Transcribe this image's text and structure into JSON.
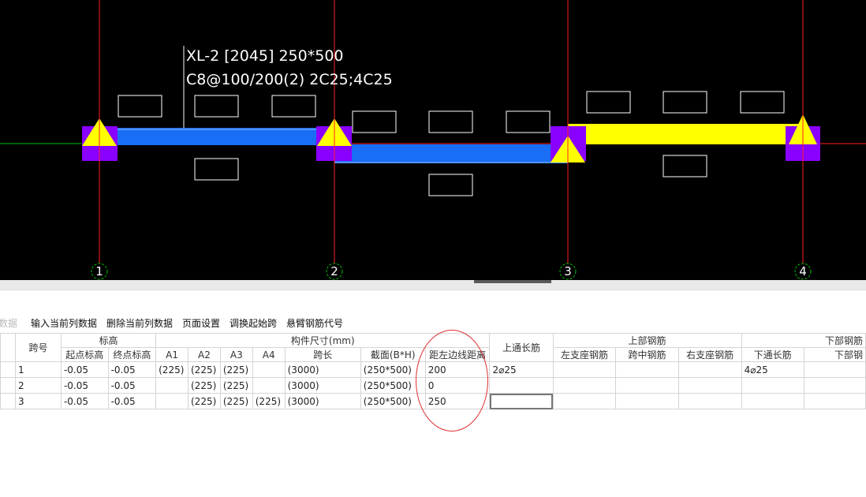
{
  "drawing": {
    "beam_label_line1": "XL-2 [2045] 250*500",
    "beam_label_line2": "C8@100/200(2) 2C25;4C25",
    "axes": [
      "1",
      "2",
      "3",
      "4"
    ],
    "colors": {
      "background": "#000000",
      "grid_line": "#ff2020",
      "beam_blue": "#1a6ef5",
      "beam_selected": "#ffff00",
      "support": "#8a00ff",
      "axis_circle": "#00c000"
    }
  },
  "toolbar": {
    "partial_label": "数据",
    "input_column": "输入当前列数据",
    "delete_column": "删除当前列数据",
    "page_setup": "页面设置",
    "swap_start_span": "调换起始跨",
    "cantilever_code": "悬臂钢筋代号"
  },
  "table": {
    "group_headers": {
      "span_no": "跨号",
      "elevation": "标高",
      "dimensions": "构件尺寸(mm)",
      "top_through": "上通长筋",
      "top_rebar": "上部钢筋",
      "bottom_rebar": "下部钢筋"
    },
    "sub_headers": {
      "start_elev": "起点标高",
      "end_elev": "终点标高",
      "a1": "A1",
      "a2": "A2",
      "a3": "A3",
      "a4": "A4",
      "span_length": "跨长",
      "section": "截面(B*H)",
      "left_offset": "距左边线距离",
      "left_support": "左支座钢筋",
      "mid_span": "跨中钢筋",
      "right_support": "右支座钢筋",
      "bottom_through": "下通长筋",
      "bottom_partial": "下部钢"
    },
    "rows": [
      {
        "span": "1",
        "start": "-0.05",
        "end": "-0.05",
        "a1": "(225)",
        "a2": "(225)",
        "a3": "(225)",
        "a4": "",
        "length": "(3000)",
        "section": "(250*500)",
        "offset": "200",
        "top_through": "2⌀25",
        "bottom_through": "4⌀25"
      },
      {
        "span": "2",
        "start": "-0.05",
        "end": "-0.05",
        "a1": "",
        "a2": "(225)",
        "a3": "(225)",
        "a4": "",
        "length": "(3000)",
        "section": "(250*500)",
        "offset": "0",
        "top_through": "",
        "bottom_through": ""
      },
      {
        "span": "3",
        "start": "-0.05",
        "end": "-0.05",
        "a1": "",
        "a2": "(225)",
        "a3": "(225)",
        "a4": "(225)",
        "length": "(3000)",
        "section": "(250*500)",
        "offset": "250",
        "top_through": "",
        "bottom_through": ""
      }
    ]
  }
}
